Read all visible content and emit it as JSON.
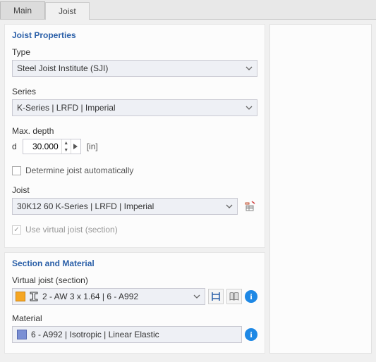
{
  "tabs": {
    "main": "Main",
    "joist": "Joist"
  },
  "panel1": {
    "title": "Joist Properties",
    "type_label": "Type",
    "type_value": "Steel Joist Institute (SJI)",
    "series_label": "Series",
    "series_value": "K-Series | LRFD | Imperial",
    "maxdepth_label": "Max. depth",
    "d_label": "d",
    "d_value": "30.000",
    "d_unit": "[in]",
    "auto_label": "Determine joist automatically",
    "joist_label": "Joist",
    "joist_value": "30K12 60 K-Series | LRFD | Imperial",
    "virtual_label": "Use virtual joist (section)"
  },
  "panel2": {
    "title": "Section and Material",
    "vj_label": "Virtual joist (section)",
    "vj_value": "2 - AW 3 x 1.64 | 6 - A992",
    "material_label": "Material",
    "material_value": "6 - A992 | Isotropic | Linear Elastic"
  }
}
